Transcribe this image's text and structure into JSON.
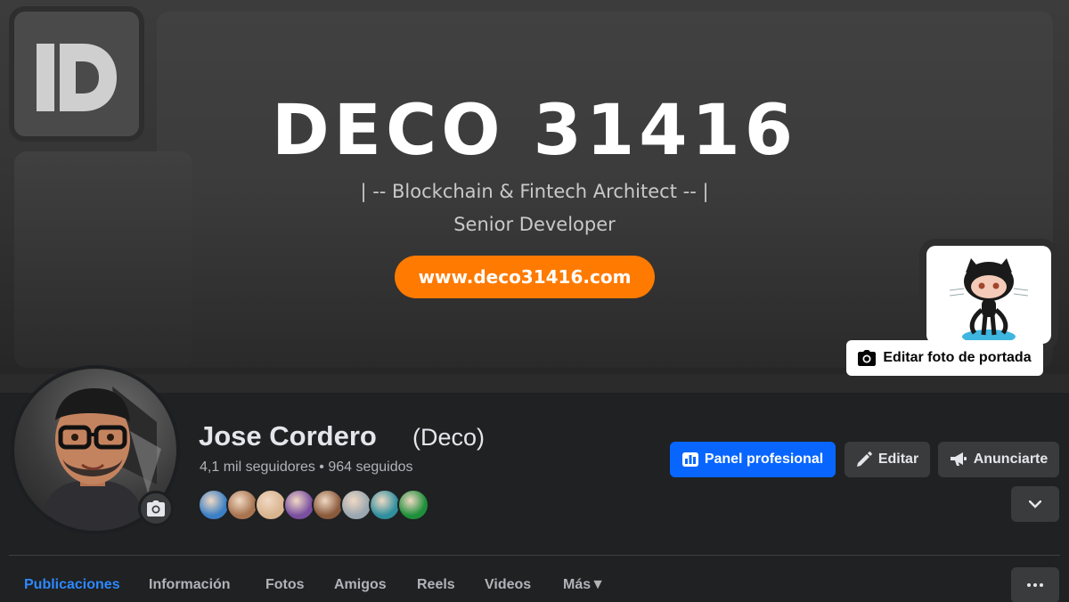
{
  "cover": {
    "brand_title": "DECO 31416",
    "brand_subtitle_1": "| -- Blockchain & Fintech Architect -- |",
    "brand_subtitle_2": "Senior Developer",
    "brand_url": "www.deco31416.com",
    "logo_icon": "deco-logo-icon",
    "badge_icon": "github-octocat-icon",
    "edit_cover_label": "Editar foto de portada",
    "accent_color": "#ff7a00"
  },
  "profile": {
    "name": "Jose Cordero",
    "nickname": "(Deco)",
    "followers_text": "4,1 mil seguidores • 964 seguidos",
    "friend_avatars": [
      "#3b7fc4",
      "#a8734f",
      "#d9b48f",
      "#7a4fa0",
      "#8a5a3c",
      "#9aa7b0",
      "#2f8f9d",
      "#1e8f3a"
    ]
  },
  "actions": {
    "panel_label": "Panel profesional",
    "edit_label": "Editar",
    "ads_label": "Anunciarte",
    "primary_color": "#0866ff"
  },
  "tabs": [
    {
      "label": "Publicaciones",
      "active": true
    },
    {
      "label": "Información",
      "active": false
    },
    {
      "label": "Fotos",
      "active": false
    },
    {
      "label": "Amigos",
      "active": false
    },
    {
      "label": "Reels",
      "active": false
    },
    {
      "label": "Videos",
      "active": false
    },
    {
      "label": "Más",
      "active": false
    }
  ]
}
